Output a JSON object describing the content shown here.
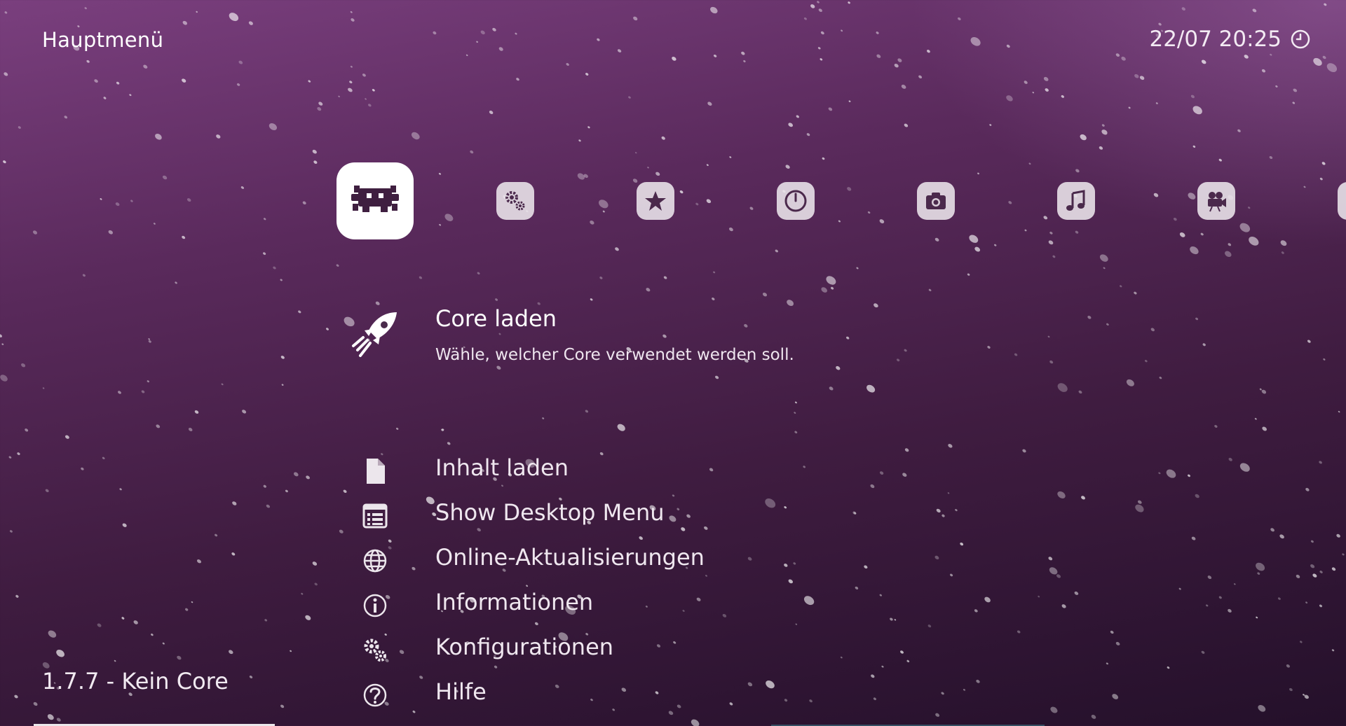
{
  "header": {
    "title": "Hauptmenü",
    "clock": "22/07 20:25"
  },
  "tabs": [
    {
      "name": "main-menu",
      "icon": "retroarch-invader-icon",
      "active": true
    },
    {
      "name": "settings",
      "icon": "settings-gears-icon"
    },
    {
      "name": "favorites",
      "icon": "favorites-star-icon"
    },
    {
      "name": "history",
      "icon": "history-clock-icon"
    },
    {
      "name": "images",
      "icon": "camera-icon"
    },
    {
      "name": "music",
      "icon": "music-note-icon"
    },
    {
      "name": "videos",
      "icon": "film-camera-icon"
    },
    {
      "name": "more",
      "icon": "partial-tab-icon"
    }
  ],
  "selected": {
    "label": "Core laden",
    "sublabel": "Wähle, welcher Core verwendet werden soll.",
    "icon": "rocket-icon"
  },
  "items": [
    {
      "label": "Inhalt laden",
      "icon": "file-icon"
    },
    {
      "label": "Show Desktop Menu",
      "icon": "list-window-icon"
    },
    {
      "label": "Online-Aktualisierungen",
      "icon": "globe-icon"
    },
    {
      "label": "Informationen",
      "icon": "info-icon"
    },
    {
      "label": "Konfigurationen",
      "icon": "gears-icon"
    },
    {
      "label": "Hilfe",
      "icon": "help-icon"
    }
  ],
  "footer": {
    "version": "1.7.7 - Kein Core"
  },
  "colors": {
    "bg_top": "#7a3f7e",
    "bg_bottom": "#24102a",
    "icon_tile": "#ece6ec"
  }
}
